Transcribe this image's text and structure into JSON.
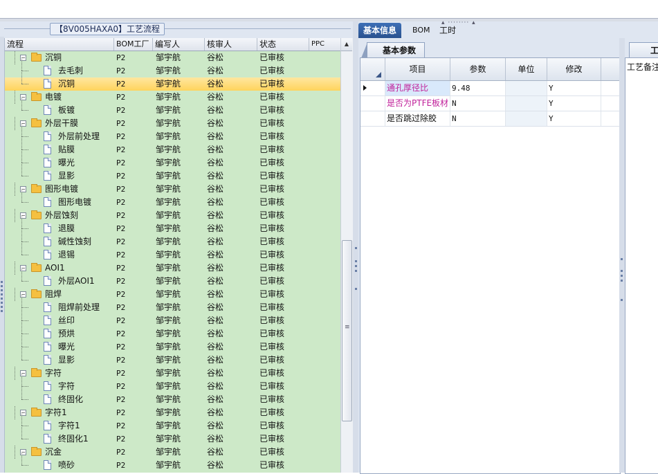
{
  "left_panel": {
    "title": "【8V005HAXA0】工艺流程",
    "columns": [
      "流程",
      "BOM工厂",
      "编写人",
      "核审人",
      "状态",
      "PPC"
    ],
    "rows": [
      {
        "name": "沉铜",
        "level": 0,
        "type": "folder",
        "expanded": true,
        "bom": "P2",
        "author": "邹宇航",
        "reviewer": "谷松",
        "status": "已审核"
      },
      {
        "name": "去毛刺",
        "level": 1,
        "type": "doc",
        "bom": "P2",
        "author": "邹宇航",
        "reviewer": "谷松",
        "status": "已审核"
      },
      {
        "name": "沉铜",
        "level": 1,
        "type": "doc",
        "bom": "P2",
        "author": "邹宇航",
        "reviewer": "谷松",
        "status": "已审核",
        "selected": true
      },
      {
        "name": "电镀",
        "level": 0,
        "type": "folder",
        "expanded": true,
        "bom": "P2",
        "author": "邹宇航",
        "reviewer": "谷松",
        "status": "已审核"
      },
      {
        "name": "板镀",
        "level": 1,
        "type": "doc",
        "bom": "P2",
        "author": "邹宇航",
        "reviewer": "谷松",
        "status": "已审核"
      },
      {
        "name": "外层干膜",
        "level": 0,
        "type": "folder",
        "expanded": true,
        "bom": "P2",
        "author": "邹宇航",
        "reviewer": "谷松",
        "status": "已审核"
      },
      {
        "name": "外层前处理",
        "level": 1,
        "type": "doc",
        "bom": "P2",
        "author": "邹宇航",
        "reviewer": "谷松",
        "status": "已审核"
      },
      {
        "name": "贴膜",
        "level": 1,
        "type": "doc",
        "bom": "P2",
        "author": "邹宇航",
        "reviewer": "谷松",
        "status": "已审核"
      },
      {
        "name": "曝光",
        "level": 1,
        "type": "doc",
        "bom": "P2",
        "author": "邹宇航",
        "reviewer": "谷松",
        "status": "已审核"
      },
      {
        "name": "显影",
        "level": 1,
        "type": "doc",
        "bom": "P2",
        "author": "邹宇航",
        "reviewer": "谷松",
        "status": "已审核"
      },
      {
        "name": "图形电镀",
        "level": 0,
        "type": "folder",
        "expanded": true,
        "bom": "P2",
        "author": "邹宇航",
        "reviewer": "谷松",
        "status": "已审核"
      },
      {
        "name": "图形电镀",
        "level": 1,
        "type": "doc",
        "bom": "P2",
        "author": "邹宇航",
        "reviewer": "谷松",
        "status": "已审核"
      },
      {
        "name": "外层蚀刻",
        "level": 0,
        "type": "folder",
        "expanded": true,
        "bom": "P2",
        "author": "邹宇航",
        "reviewer": "谷松",
        "status": "已审核"
      },
      {
        "name": "退膜",
        "level": 1,
        "type": "doc",
        "bom": "P2",
        "author": "邹宇航",
        "reviewer": "谷松",
        "status": "已审核"
      },
      {
        "name": "碱性蚀刻",
        "level": 1,
        "type": "doc",
        "bom": "P2",
        "author": "邹宇航",
        "reviewer": "谷松",
        "status": "已审核"
      },
      {
        "name": "退锡",
        "level": 1,
        "type": "doc",
        "bom": "P2",
        "author": "邹宇航",
        "reviewer": "谷松",
        "status": "已审核"
      },
      {
        "name": "AOI1",
        "level": 0,
        "type": "folder",
        "expanded": true,
        "bom": "P2",
        "author": "邹宇航",
        "reviewer": "谷松",
        "status": "已审核"
      },
      {
        "name": "外层AOI1",
        "level": 1,
        "type": "doc",
        "bom": "P2",
        "author": "邹宇航",
        "reviewer": "谷松",
        "status": "已审核"
      },
      {
        "name": "阻焊",
        "level": 0,
        "type": "folder",
        "expanded": true,
        "bom": "P2",
        "author": "邹宇航",
        "reviewer": "谷松",
        "status": "已审核"
      },
      {
        "name": "阻焊前处理",
        "level": 1,
        "type": "doc",
        "bom": "P2",
        "author": "邹宇航",
        "reviewer": "谷松",
        "status": "已审核"
      },
      {
        "name": "丝印",
        "level": 1,
        "type": "doc",
        "bom": "P2",
        "author": "邹宇航",
        "reviewer": "谷松",
        "status": "已审核"
      },
      {
        "name": "预烘",
        "level": 1,
        "type": "doc",
        "bom": "P2",
        "author": "邹宇航",
        "reviewer": "谷松",
        "status": "已审核"
      },
      {
        "name": "曝光",
        "level": 1,
        "type": "doc",
        "bom": "P2",
        "author": "邹宇航",
        "reviewer": "谷松",
        "status": "已审核"
      },
      {
        "name": "显影",
        "level": 1,
        "type": "doc",
        "bom": "P2",
        "author": "邹宇航",
        "reviewer": "谷松",
        "status": "已审核"
      },
      {
        "name": "字符",
        "level": 0,
        "type": "folder",
        "expanded": true,
        "bom": "P2",
        "author": "邹宇航",
        "reviewer": "谷松",
        "status": "已审核"
      },
      {
        "name": "字符",
        "level": 1,
        "type": "doc",
        "bom": "P2",
        "author": "邹宇航",
        "reviewer": "谷松",
        "status": "已审核"
      },
      {
        "name": "终固化",
        "level": 1,
        "type": "doc",
        "bom": "P2",
        "author": "邹宇航",
        "reviewer": "谷松",
        "status": "已审核"
      },
      {
        "name": "字符1",
        "level": 0,
        "type": "folder",
        "expanded": true,
        "bom": "P2",
        "author": "邹宇航",
        "reviewer": "谷松",
        "status": "已审核"
      },
      {
        "name": "字符1",
        "level": 1,
        "type": "doc",
        "bom": "P2",
        "author": "邹宇航",
        "reviewer": "谷松",
        "status": "已审核"
      },
      {
        "name": "终固化1",
        "level": 1,
        "type": "doc",
        "bom": "P2",
        "author": "邹宇航",
        "reviewer": "谷松",
        "status": "已审核"
      },
      {
        "name": "沉金",
        "level": 0,
        "type": "folder",
        "expanded": true,
        "bom": "P2",
        "author": "邹宇航",
        "reviewer": "谷松",
        "status": "已审核"
      },
      {
        "name": "喷砂",
        "level": 1,
        "type": "doc",
        "bom": "P2",
        "author": "邹宇航",
        "reviewer": "谷松",
        "status": "已审核"
      }
    ]
  },
  "right_panel": {
    "tabs": [
      "基本信息",
      "BOM",
      "工时"
    ],
    "active_tab": 0,
    "sub_tab": "基本参数",
    "param_columns": [
      "项目",
      "参数",
      "单位",
      "修改"
    ],
    "params": [
      {
        "item": "通孔厚径比",
        "value": "9.48",
        "unit": "",
        "modified": "Y",
        "color": "#c0209a",
        "current": true
      },
      {
        "item": "是否为PTFE板材",
        "value": "N",
        "unit": "",
        "modified": "Y",
        "color": "#c0209a",
        "current": false
      },
      {
        "item": "是否跳过除胶",
        "value": "N",
        "unit": "",
        "modified": "Y",
        "color": "#111111",
        "current": false
      }
    ],
    "far_tab": "工",
    "far_label": "工艺备注"
  },
  "colors": {
    "grid_bg": "#cde9c8",
    "selection": "#ffd45c",
    "active_tab": "#2a528f",
    "panel_bg": "#dfe6f1"
  }
}
